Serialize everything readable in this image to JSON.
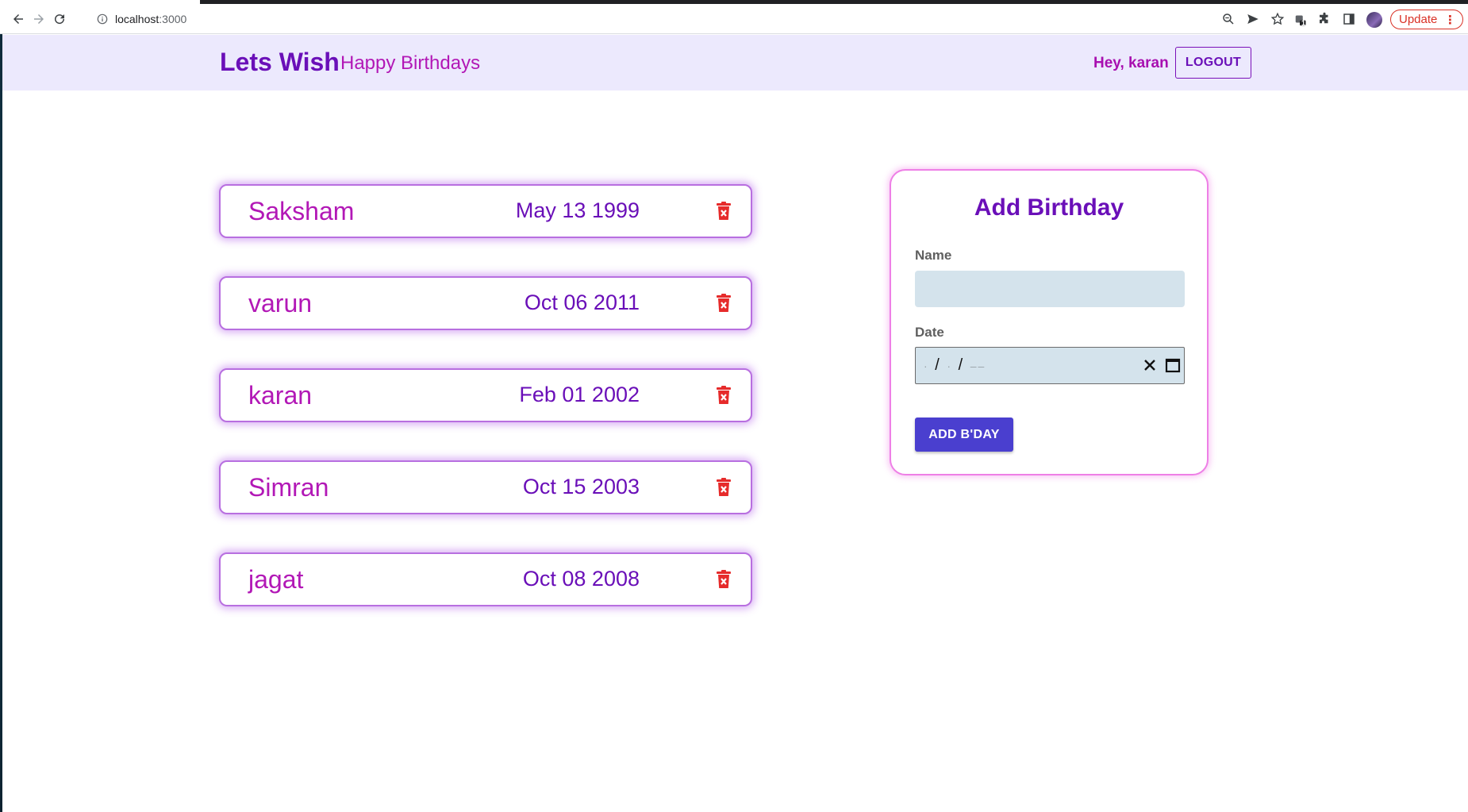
{
  "browser": {
    "url_host": "localhost",
    "url_port": ":3000",
    "update_label": "Update",
    "menu_glyph": "⋮",
    "extension_badge": "1",
    "icons": [
      "back-icon",
      "forward-icon",
      "reload-icon",
      "site-info-icon",
      "zoom-icon",
      "send-icon",
      "star-icon",
      "extension-icon",
      "puzzle-icon",
      "side-panel-icon"
    ]
  },
  "header": {
    "brand": "Lets Wish",
    "tagline": "Happy Birthdays",
    "greeting": "Hey, karan",
    "logout_label": "LOGOUT"
  },
  "birthdays": [
    {
      "name": "Saksham",
      "date": "May 13 1999"
    },
    {
      "name": "varun",
      "date": "Oct 06 2011"
    },
    {
      "name": "karan",
      "date": "Feb 01 2002"
    },
    {
      "name": "Simran",
      "date": "Oct 15 2003"
    },
    {
      "name": "jagat",
      "date": "Oct 08 2008"
    }
  ],
  "form": {
    "title": "Add Birthday",
    "name_label": "Name",
    "name_value": "",
    "date_label": "Date",
    "date_value": "",
    "submit_label": "ADD B'DAY"
  },
  "colors": {
    "brand_purple": "#6a0fb8",
    "magenta": "#b218b6",
    "header_bg": "#ece9fd",
    "input_bg": "#d4e3ec",
    "button_blue": "#4a3fcf",
    "delete_red": "#e62b2b",
    "update_red": "#d93025"
  }
}
